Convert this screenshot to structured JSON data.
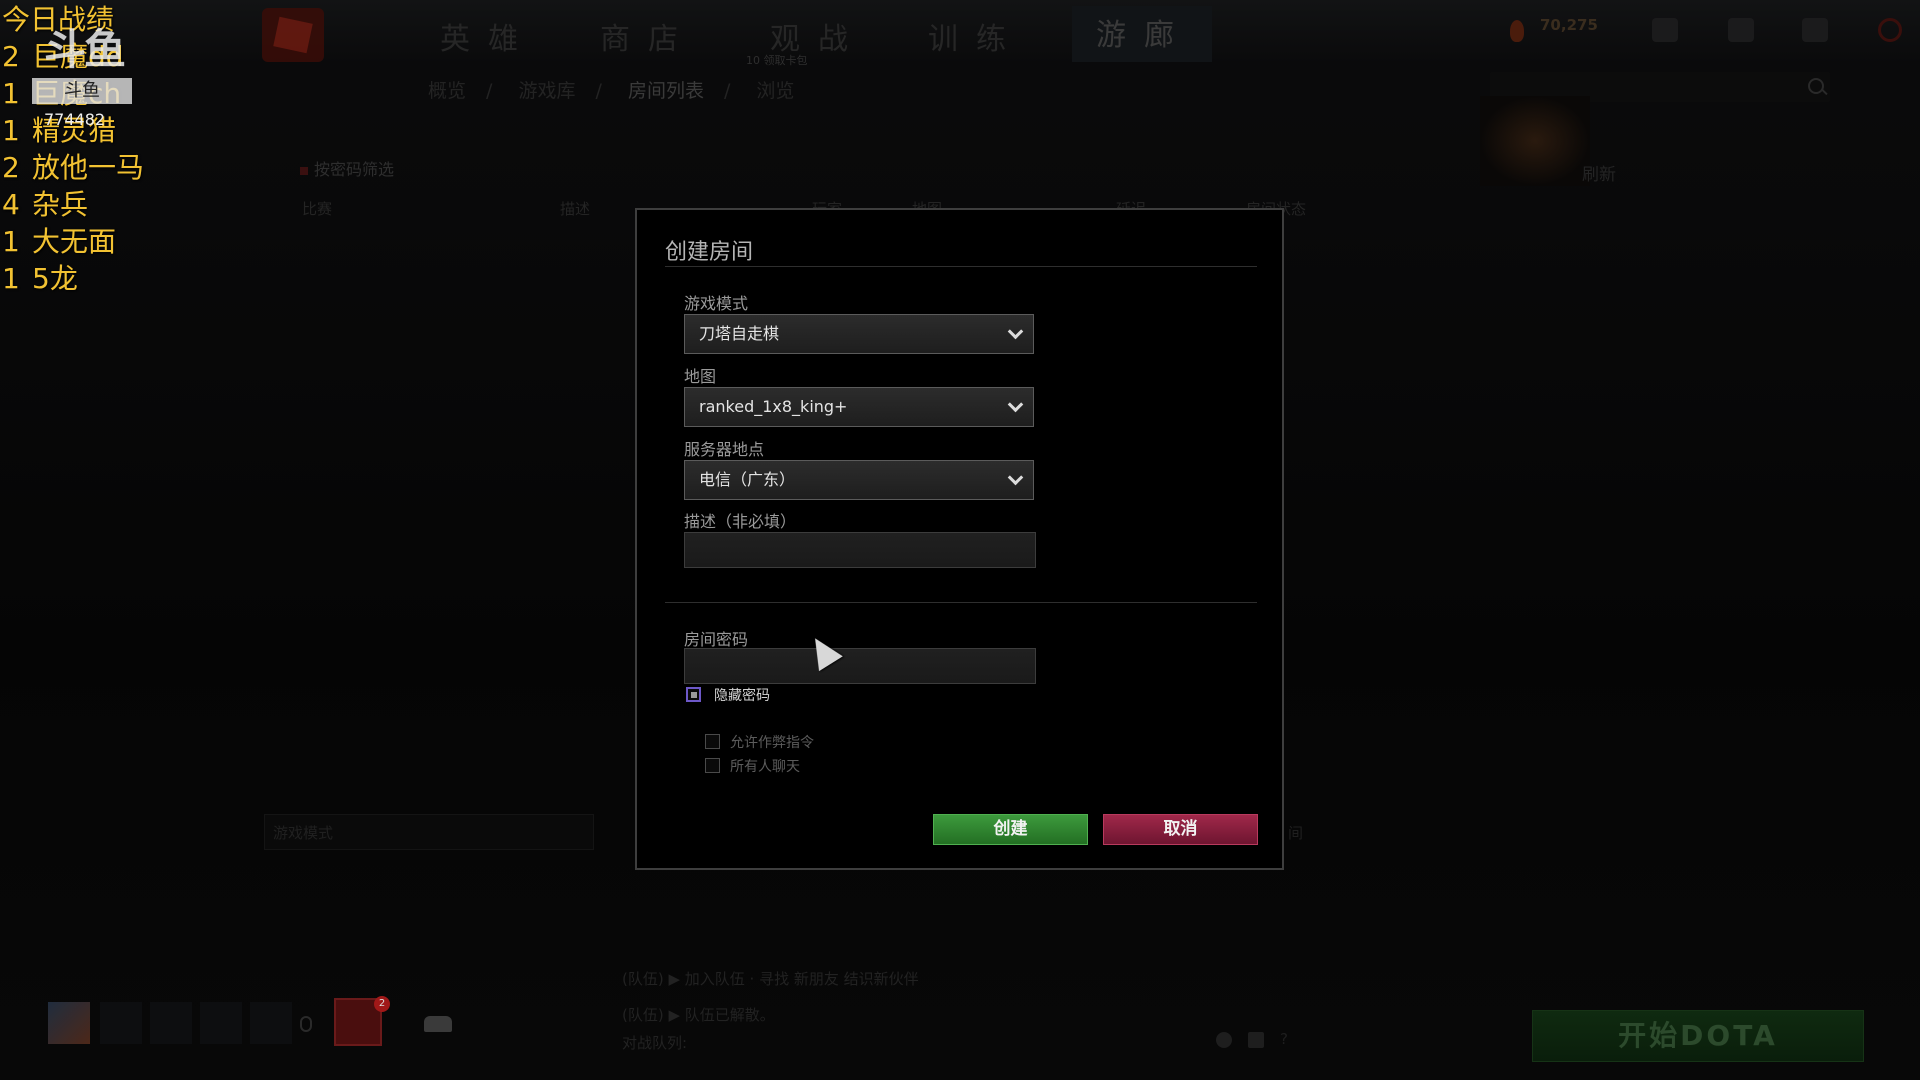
{
  "overlay": {
    "title": "今日战绩",
    "records": [
      {
        "count": "2",
        "name": "巨魔dd"
      },
      {
        "count": "1",
        "name": "巨魔ch"
      },
      {
        "count": "1",
        "name": "精灵猎"
      },
      {
        "count": "2",
        "name": "放他一马"
      },
      {
        "count": "4",
        "name": "杂兵"
      },
      {
        "count": "1",
        "name": "大无面"
      },
      {
        "count": "1",
        "name": "5龙"
      }
    ],
    "watermark_logo": "斗鱼",
    "watermark_box": "斗鱼",
    "room_id": "774482"
  },
  "background": {
    "nav_tabs": [
      "英雄",
      "商店",
      "观战",
      "训练",
      "游廊"
    ],
    "nav_badge": "10 领取卡包",
    "breadcrumb": [
      "概览",
      "游戏库",
      "房间列表",
      "浏览"
    ],
    "currency": "70,275",
    "password_filter": "按密码筛选",
    "refresh_label": "刷新",
    "columns": [
      "比赛",
      "描述",
      "玩家",
      "地图",
      "延迟",
      "房间状态"
    ],
    "filter_placeholder": "游戏模式",
    "right_fragment": "间",
    "party_status": "(队伍) ▶ 加入队伍 · 寻找 新朋友 结识新伙伴",
    "party_status2": "(队伍) ▶ 队伍已解散。",
    "queue_status": "对战队列:",
    "play_button": "开始DOTA"
  },
  "modal": {
    "title": "创建房间",
    "game_mode_label": "游戏模式",
    "game_mode_value": "刀塔自走棋",
    "map_label": "地图",
    "map_value": "ranked_1x8_king+",
    "server_label": "服务器地点",
    "server_value": "电信（广东）",
    "desc_label": "描述（非必填）",
    "desc_value": "",
    "password_label": "房间密码",
    "password_value": "",
    "hide_password_label": "隐藏密码",
    "allow_cheats_label": "允许作弊指令",
    "all_chat_label": "所有人聊天",
    "create_button": "创建",
    "cancel_button": "取消"
  }
}
